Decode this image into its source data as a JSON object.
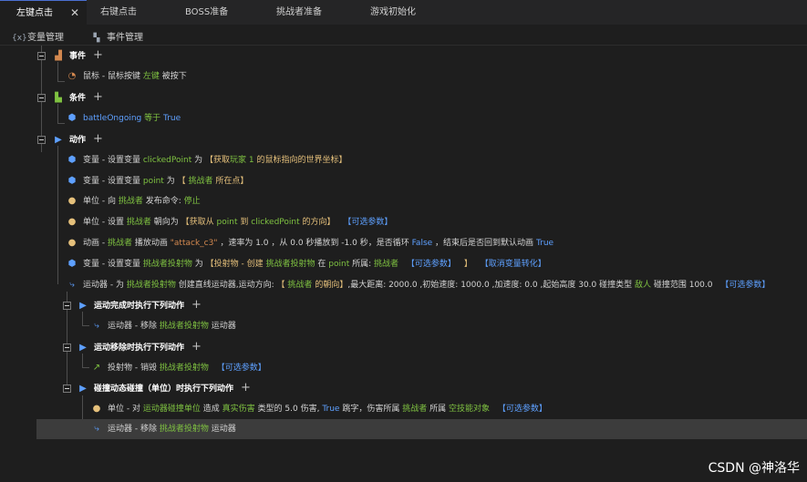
{
  "tabs": [
    {
      "label": "左键点击",
      "active": true
    },
    {
      "label": "右键点击"
    },
    {
      "label": "BOSS准备"
    },
    {
      "label": "挑战者准备"
    },
    {
      "label": "游戏初始化"
    }
  ],
  "toolbar": {
    "variables": "变量管理",
    "events": "事件管理"
  },
  "tree": {
    "event_header": "事件",
    "event_1": {
      "a": "鼠标 - 鼠标按键",
      "b": "左键",
      "c": "被按下"
    },
    "condition_header": "条件",
    "condition_1": {
      "a": "battleOngoing",
      "b": "等于",
      "c": "True"
    },
    "action_header": "动作",
    "a1": {
      "p1": "变量 - 设置变量",
      "p2": "clickedPoint",
      "p3": "为",
      "p4": "【获取",
      "p5": "玩家 1",
      "p6": "的鼠标指向的世界坐标】"
    },
    "a2": {
      "p1": "变量 - 设置变量",
      "p2": "point",
      "p3": "为",
      "p4": "【",
      "p5": "挑战者",
      "p6": "所在点】"
    },
    "a3": {
      "p1": "单位 - 向",
      "p2": "挑战者",
      "p3": "发布命令:",
      "p4": "停止"
    },
    "a4": {
      "p1": "单位 - 设置",
      "p2": "挑战者",
      "p3": "朝向为",
      "p4": "【获取从",
      "p5": "point",
      "p6": "到",
      "p7": "clickedPoint",
      "p8": "的方向】",
      "p9": "【可选参数】"
    },
    "a5": {
      "p1": "动画 -",
      "p2": "挑战者",
      "p3": "播放动画",
      "p4": "\"attack_c3\"",
      "p5": "，速率为 1.0 ，从 0.0 秒播放到 -1.0 秒，是否循环",
      "p6": "False",
      "p7": "，结束后是否回到默认动画",
      "p8": "True"
    },
    "a6": {
      "p1": "变量 - 设置变量",
      "p2": "挑战者投射物",
      "p3": "为",
      "p4": "【投射物 - 创建",
      "p5": "挑战者投射物",
      "p6": "在",
      "p7": "point",
      "p8": "所属:",
      "p9": "挑战者",
      "p10": "【可选参数】",
      "p11": "】",
      "p12": "【取消变量转化】"
    },
    "a7": {
      "p1": "运动器 - 为",
      "p2": "挑战者投射物",
      "p3": "创建直线运动器,运动方向:",
      "p4": "【",
      "p5": "挑战者",
      "p6": "的朝向】",
      "p7": ",最大距离: 2000.0 ,初始速度: 1000.0 ,加速度: 0.0 ,起始高度 30.0 碰撞类型",
      "p8": "敌人",
      "p9": "碰撞范围 100.0",
      "p10": "【可选参数】"
    },
    "sub1_header": "运动完成时执行下列动作",
    "sub1_a": {
      "p1": "运动器 - 移除",
      "p2": "挑战者投射物",
      "p3": "运动器"
    },
    "sub2_header": "运动移除时执行下列动作",
    "sub2_a": {
      "p1": "投射物 - 销毁",
      "p2": "挑战者投射物",
      "p3": "【可选参数】"
    },
    "sub3_header": "碰撞动态碰撞（单位）时执行下列动作",
    "sub3_a1": {
      "p1": "单位 - 对",
      "p2": "运动器碰撞单位",
      "p3": "造成",
      "p4": "真实伤害",
      "p5": "类型的 5.0 伤害,",
      "p6": "True",
      "p7": "跳字，伤害所属",
      "p8": "挑战者",
      "p9": "所属",
      "p10": "空技能对象",
      "p11": "【可选参数】"
    },
    "sub3_a2": {
      "p1": "运动器 - 移除",
      "p2": "挑战者投射物",
      "p3": "运动器"
    }
  },
  "watermark": "CSDN @神洛华"
}
